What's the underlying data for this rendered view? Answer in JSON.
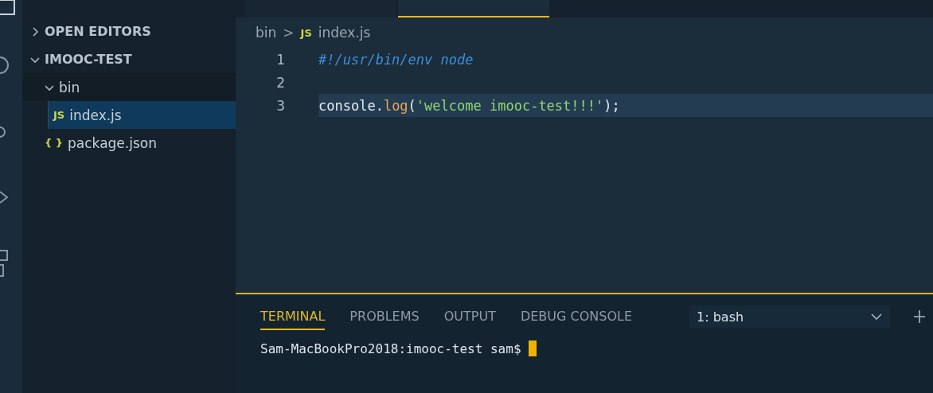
{
  "editor_tabs": [
    {
      "selected": false
    },
    {
      "selected": true
    }
  ],
  "sidebar": {
    "sections": [
      {
        "label": "OPEN EDITORS",
        "expanded": false
      },
      {
        "label": "IMOOC-TEST",
        "expanded": true,
        "children": [
          {
            "label": "bin",
            "kind": "folder",
            "expanded": true,
            "selected": false,
            "children": [
              {
                "label": "index.js",
                "kind": "file",
                "icon": "JS",
                "selected": true
              }
            ]
          },
          {
            "label": "package.json",
            "kind": "file",
            "icon": "{ }",
            "selected": false
          }
        ]
      }
    ]
  },
  "breadcrumb": {
    "folder": "bin",
    "separator": ">",
    "file_icon": "JS",
    "file": "index.js"
  },
  "code_lines": [
    {
      "number": "1",
      "current": false,
      "tokens": [
        {
          "kind": "comment",
          "text": "#!/usr/bin/env node"
        }
      ]
    },
    {
      "number": "2",
      "current": false
    },
    {
      "number": "3",
      "current": true,
      "tokens": [
        {
          "kind": "plain",
          "text": "console."
        },
        {
          "kind": "function",
          "text": "log"
        },
        {
          "kind": "plain",
          "text": "("
        },
        {
          "kind": "string",
          "text": "'welcome imooc-test!!!'"
        },
        {
          "kind": "plain",
          "text": ");"
        }
      ]
    }
  ],
  "panel": {
    "tabs": [
      {
        "label": "TERMINAL",
        "selected": true
      },
      {
        "label": "PROBLEMS",
        "selected": false
      },
      {
        "label": "OUTPUT",
        "selected": false
      },
      {
        "label": "DEBUG CONSOLE",
        "selected": false
      }
    ],
    "terminal_select": "1: bash",
    "prompt": "Sam-MacBookPro2018:imooc-test sam$"
  }
}
